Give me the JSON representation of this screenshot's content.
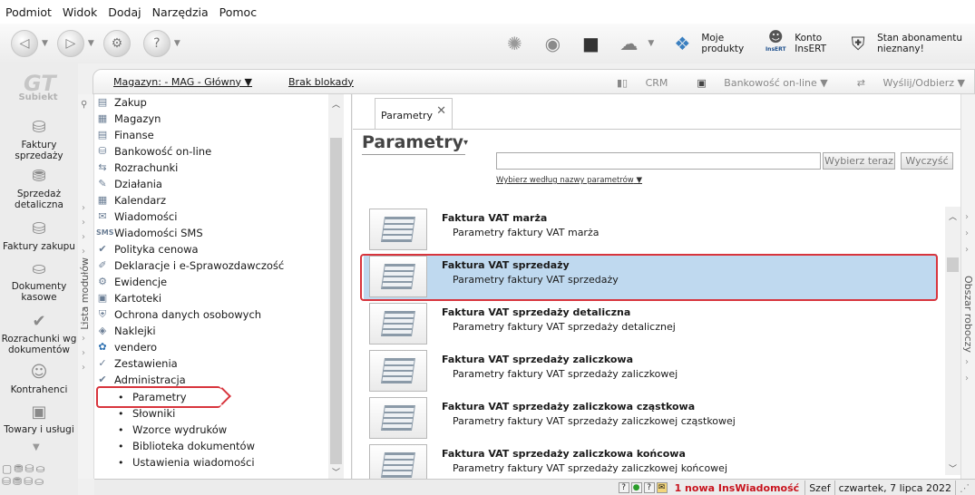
{
  "menu": [
    "Podmiot",
    "Widok",
    "Dodaj",
    "Narzędzia",
    "Pomoc"
  ],
  "toolbar": {
    "moje_produkty": [
      "Moje",
      "produkty"
    ],
    "konto": [
      "Konto",
      "InsERT"
    ],
    "stan": [
      "Stan abonamentu",
      "nieznany!"
    ],
    "insert_badge": "InsERT"
  },
  "logo": "Subiekt",
  "left_nav": [
    {
      "lines": [
        "Faktury",
        "sprzedaży"
      ]
    },
    {
      "lines": [
        "Sprzedaż",
        "detaliczna"
      ]
    },
    {
      "lines": [
        "Faktury zakupu"
      ]
    },
    {
      "lines": [
        "Dokumenty",
        "kasowe"
      ]
    },
    {
      "lines": [
        "Rozrachunki wg",
        "dokumentów"
      ]
    },
    {
      "lines": [
        "Kontrahenci"
      ]
    },
    {
      "lines": [
        "Towary i usługi"
      ]
    }
  ],
  "header": {
    "magazyn": "Magazyn: - MAG - Główny",
    "blokada": "Brak blokady",
    "crm": "CRM",
    "bank": "Bankowość on-line",
    "wyslij": "Wyślij/Odbierz"
  },
  "module_strip_label": "Lista modułów",
  "modules": [
    "Zakup",
    "Magazyn",
    "Finanse",
    "Bankowość on-line",
    "Rozrachunki",
    "Działania",
    "Kalendarz",
    "Wiadomości",
    "Wiadomości SMS",
    "Polityka cenowa",
    "Deklaracje i e-Sprawozdawczość",
    "Ewidencje",
    "Kartoteki",
    "Ochrona danych osobowych",
    "Naklejki",
    "vendero",
    "Zestawienia",
    "Administracja"
  ],
  "sub_modules": [
    "Parametry",
    "Słowniki",
    "Wzorce wydruków",
    "Biblioteka dokumentów",
    "Ustawienia wiadomości"
  ],
  "tab": {
    "label": "Parametry"
  },
  "page_title": "Parametry",
  "search": {
    "value": "",
    "choose": "Wybierz teraz",
    "clear": "Wyczyść",
    "filter": "Wybierz według nazwy parametrów"
  },
  "rows": [
    {
      "title": "Faktura VAT marża",
      "sub": "Parametry faktury VAT marża"
    },
    {
      "title": "Faktura VAT sprzedaży",
      "sub": "Parametry faktury VAT sprzedaży"
    },
    {
      "title": "Faktura VAT sprzedaży detaliczna",
      "sub": "Parametry faktury VAT sprzedaży detalicznej"
    },
    {
      "title": "Faktura VAT sprzedaży zaliczkowa",
      "sub": "Parametry faktury VAT sprzedaży zaliczkowej"
    },
    {
      "title": "Faktura VAT sprzedaży zaliczkowa cząstkowa",
      "sub": "Parametry faktury VAT sprzedaży zaliczkowej cząstkowej"
    },
    {
      "title": "Faktura VAT sprzedaży zaliczkowa końcowa",
      "sub": "Parametry faktury VAT sprzedaży zaliczkowej końcowej"
    }
  ],
  "work_area_label": "Obszar roboczy",
  "status": {
    "news": "1 nowa InsWiadomość",
    "szef": "Szef",
    "date": "czwartek, 7 lipca 2022"
  },
  "colors": {
    "accent": "#d8353d",
    "selection": "#bfd9ef"
  }
}
